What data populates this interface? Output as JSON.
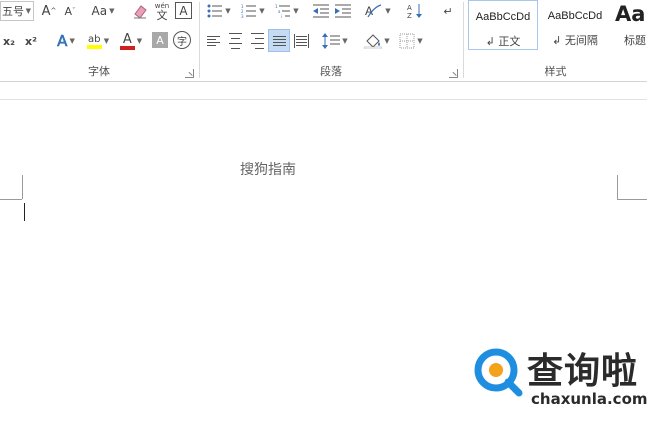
{
  "ribbon": {
    "font_group": {
      "label": "字体",
      "font_size_value": "五号",
      "grow_font_label": "A",
      "shrink_font_label": "A",
      "change_case_label": "Aa",
      "phonetic_top": "wén",
      "phonetic_bottom": "文",
      "char_border_label": "A",
      "subscript_label": "x₂",
      "superscript_label": "x²",
      "text_effect_label": "A",
      "highlight_label": "ab",
      "font_color_label": "A",
      "char_shading_label": "A",
      "enclose_label": "字"
    },
    "paragraph_group": {
      "label": "段落"
    },
    "styles_group": {
      "label": "样式",
      "styles": [
        {
          "sample": "AaBbCcDd",
          "name": "↲ 正文"
        },
        {
          "sample": "AaBbCcDd",
          "name": "↲ 无间隔"
        },
        {
          "sample": "Aa",
          "name": "标题"
        }
      ]
    }
  },
  "document": {
    "header_text": "搜狗指南"
  },
  "watermark": {
    "title": "查询啦",
    "url": "chaxunla.com"
  },
  "colors": {
    "highlight": "#ffff00",
    "font_color": "#d02020",
    "watermark_blue": "#1e8fe0",
    "watermark_orange": "#f2a21b"
  }
}
